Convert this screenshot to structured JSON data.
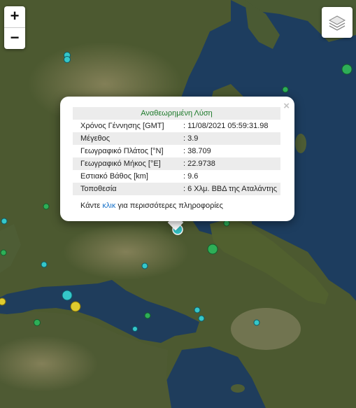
{
  "controls": {
    "zoom_in": "+",
    "zoom_out": "−",
    "layers_icon": "layers-icon"
  },
  "popup": {
    "title": "Αναθεωρημένη Λύση",
    "close": "×",
    "rows": [
      {
        "label": "Χρόνος Γέννησης [GMT]",
        "value": ": 11/08/2021 05:59:31.98"
      },
      {
        "label": "Μέγεθος",
        "value": ": 3.9"
      },
      {
        "label": "Γεωγραφικό Πλάτος [°N]",
        "value": ": 38.709"
      },
      {
        "label": "Γεωγραφικό Μήκος [°E]",
        "value": ": 22.9738"
      },
      {
        "label": "Εστιακό Βάθος [km]",
        "value": ": 9.6"
      },
      {
        "label": "Τοποθεσία",
        "value": ": 6 Χλμ. ΒΒΔ της Αταλάντης"
      }
    ],
    "more_prefix": "Κάντε ",
    "more_link": "κλικ",
    "more_suffix": " για περισσότερες πληροφορίες"
  },
  "colors": {
    "sea": "#1d3d5f",
    "land": "#4f5a31",
    "land_light": "#8f8a62",
    "marker_teal": "#35c7c9",
    "marker_green": "#2eae57",
    "marker_yellow": "#e0cb2e",
    "popup_title": "#1d7a2a",
    "link": "#1a73c9"
  }
}
